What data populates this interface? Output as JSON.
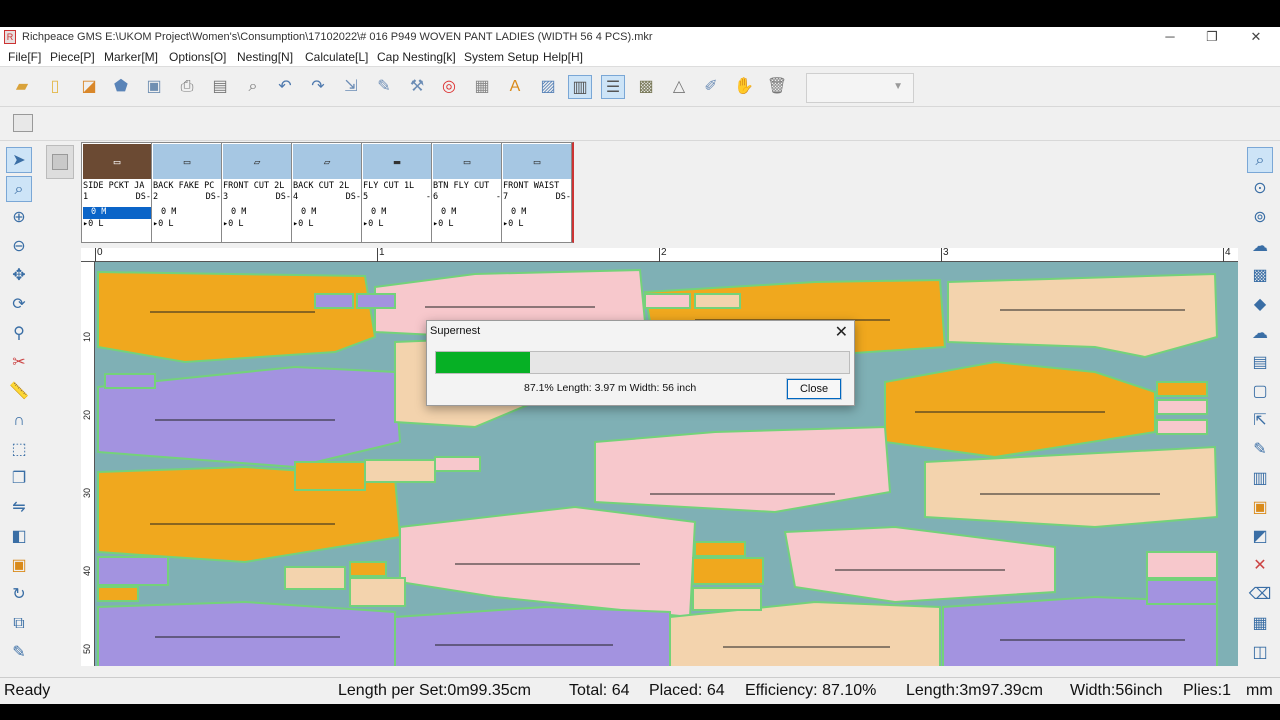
{
  "window": {
    "title": "Richpeace GMS E:\\UKOM Project\\Women's\\Consumption\\17102022\\# 016 P949 WOVEN PANT LADIES  (WIDTH 56 4 PCS).mkr",
    "app_icon": "richpeace-app-icon",
    "controls": {
      "minimize": "─",
      "restore": "❐",
      "close": "✕"
    }
  },
  "menu": [
    "File[F]",
    "Piece[P]",
    "Marker[M]",
    "Options[O]",
    "Nesting[N]",
    "Calculate[L]",
    "Cap Nesting[k]",
    "System Setup",
    "Help[H]"
  ],
  "toolbar_icons": [
    "open-folder-icon",
    "new-file-icon",
    "open-file-icon",
    "shield-icon",
    "save-icon",
    "print-icon",
    "plotter-icon",
    "zoom-page-icon",
    "undo-icon",
    "redo-icon",
    "import-icon",
    "pieces-icon",
    "tools-icon",
    "color-wheel-icon",
    "grid-icon",
    "text-icon",
    "image-icon",
    "marker-view-icon",
    "piece-list-icon",
    "layout-icon",
    "pattern-icon",
    "pen-icon",
    "hand-icon",
    "delete-icon"
  ],
  "pieces": [
    {
      "name": "SIDE PCKT JA",
      "num": "1",
      "ds": "DS-",
      "count": "0 M",
      "layer": "0 L",
      "glyph": "▭"
    },
    {
      "name": "BACK FAKE PC",
      "num": "2",
      "ds": "DS-",
      "count": "0 M",
      "layer": "0 L",
      "glyph": "▭"
    },
    {
      "name": "FRONT CUT 2L",
      "num": "3",
      "ds": "DS-",
      "count": "0 M",
      "layer": "0 L",
      "glyph": "▱"
    },
    {
      "name": "BACK CUT 2L",
      "num": "4",
      "ds": "DS-",
      "count": "0 M",
      "layer": "0 L",
      "glyph": "▱"
    },
    {
      "name": "FLY CUT 1L",
      "num": "5",
      "ds": "-",
      "count": "0 M",
      "layer": "0 L",
      "glyph": "▬"
    },
    {
      "name": "BTN FLY CUT",
      "num": "6",
      "ds": "-",
      "count": "0 M",
      "layer": "0 L",
      "glyph": "▭"
    },
    {
      "name": "FRONT WAIST",
      "num": "7",
      "ds": "DS-",
      "count": "0 M",
      "layer": "0 L",
      "glyph": "▭"
    }
  ],
  "ruler": {
    "h_labels": [
      "0",
      "1",
      "2",
      "3",
      "4"
    ],
    "v_labels": [
      "10",
      "20",
      "30",
      "40",
      "50"
    ]
  },
  "dialog": {
    "title": "Supernest",
    "progress": 0.227,
    "status": "87.1%  Length: 3.97 m  Width: 56 inch",
    "close_label": "Close"
  },
  "status": {
    "ready": "Ready",
    "length_per_set": "Length per Set:0m99.35cm",
    "total": "Total: 64",
    "placed": "Placed: 64",
    "efficiency": "Efficiency: 87.10%",
    "length": "Length:3m97.39cm",
    "width": "Width:56inch",
    "plies": "Plies:1",
    "unit": "mm"
  },
  "colors": {
    "orange": "#f0a81e",
    "pink": "#f7c8cc",
    "purple": "#a393e0",
    "peach": "#f3d3ad",
    "cloth": "#7fb0b5",
    "outline": "#74d27a",
    "progress": "#06b025"
  }
}
